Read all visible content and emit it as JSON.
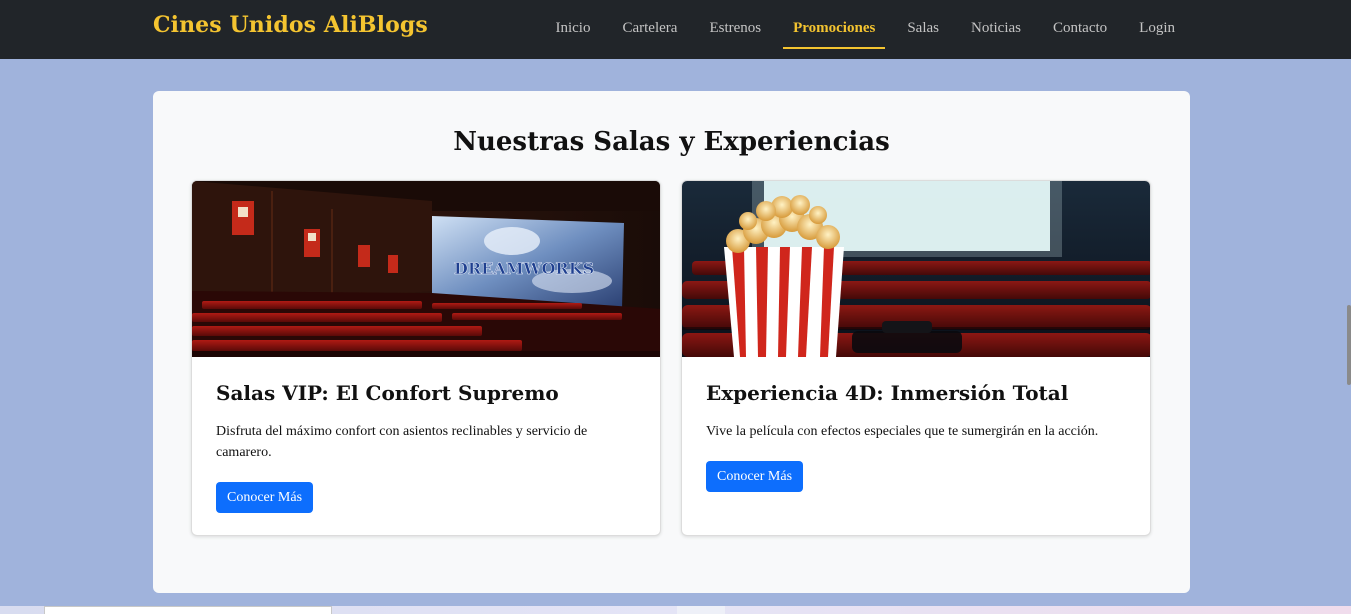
{
  "navbar": {
    "brand": "Cines Unidos AliBlogs",
    "links": [
      {
        "label": "Inicio",
        "active": false
      },
      {
        "label": "Cartelera",
        "active": false
      },
      {
        "label": "Estrenos",
        "active": false
      },
      {
        "label": "Promociones",
        "active": true
      },
      {
        "label": "Salas",
        "active": false
      },
      {
        "label": "Noticias",
        "active": false
      },
      {
        "label": "Contacto",
        "active": false
      },
      {
        "label": "Login",
        "active": false
      }
    ]
  },
  "section": {
    "title": "Nuestras Salas y Experiencias",
    "cards": [
      {
        "image": "cinema-hall-photo",
        "screen_text": "DREAMWORKS",
        "title": "Salas VIP: El Confort Supremo",
        "text": "Disfruta del máximo confort con asientos reclinables y servicio de camarero.",
        "button": "Conocer Más"
      },
      {
        "image": "popcorn-photo",
        "title": "Experiencia 4D: Inmersión Total",
        "text": "Vive la película con efectos especiales que te sumergirán en la acción.",
        "button": "Conocer Más"
      }
    ]
  },
  "colors": {
    "navbar_bg": "#212529",
    "brand": "#f4c430",
    "page_bg": "#a0b3dc",
    "button": "#0d6efd"
  }
}
